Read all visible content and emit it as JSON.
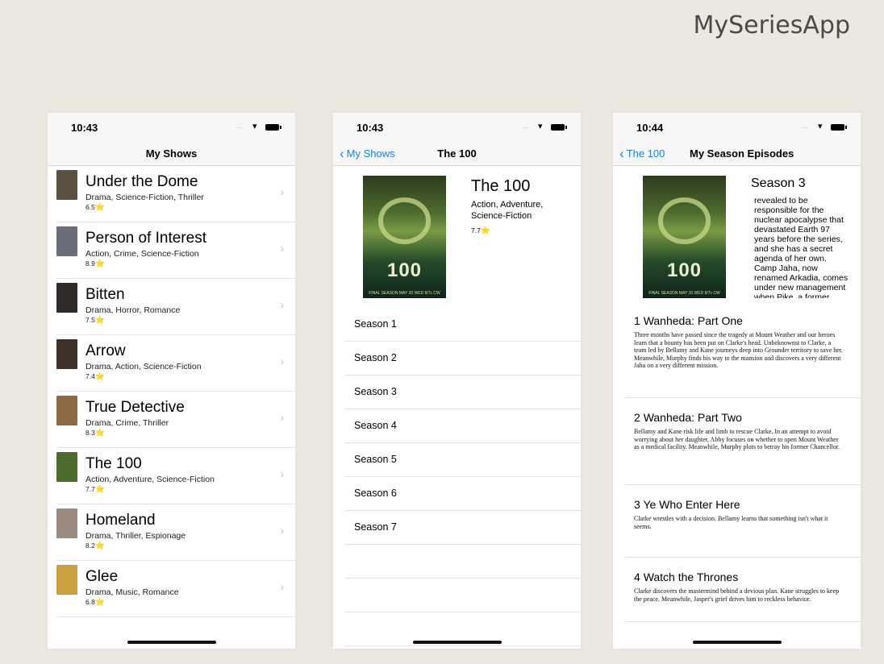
{
  "app_title": "MySeriesApp",
  "colors": {
    "accent": "#1a7ef0",
    "background": "#ebe8e1",
    "star": "#f4c430"
  },
  "screen1": {
    "time": "10:43",
    "nav_title": "My Shows",
    "shows": [
      {
        "name": "Under the Dome",
        "genres": "Drama, Science-Fiction, Thriller",
        "rating": "6.5",
        "thumb_color": "#5a5040"
      },
      {
        "name": "Person of Interest",
        "genres": "Action, Crime, Science-Fiction",
        "rating": "8.9",
        "thumb_color": "#6b6e78"
      },
      {
        "name": "Bitten",
        "genres": "Drama, Horror, Romance",
        "rating": "7.5",
        "thumb_color": "#2e2a2a"
      },
      {
        "name": "Arrow",
        "genres": "Drama, Action, Science-Fiction",
        "rating": "7.4",
        "thumb_color": "#3a3228"
      },
      {
        "name": "True Detective",
        "genres": "Drama, Crime, Thriller",
        "rating": "8.3",
        "thumb_color": "#8b6a45"
      },
      {
        "name": "The 100",
        "genres": "Action, Adventure, Science-Fiction",
        "rating": "7.7",
        "thumb_color": "#4d6b2e"
      },
      {
        "name": "Homeland",
        "genres": "Drama, Thriller, Espionage",
        "rating": "8.2",
        "thumb_color": "#9a8a80"
      },
      {
        "name": "Glee",
        "genres": "Drama, Music, Romance",
        "rating": "6.8",
        "thumb_color": "#c8a040"
      }
    ]
  },
  "screen2": {
    "time": "10:43",
    "back_label": "My Shows",
    "nav_title": "The 100",
    "show_title": "The 100",
    "genres": "Action, Adventure, Science-Fiction",
    "rating": "7.7",
    "poster_text": "100",
    "poster_footer": "FINAL SEASON MAY 20 WED 8/7c CW",
    "seasons": [
      "Season 1",
      "Season 2",
      "Season 3",
      "Season 4",
      "Season 5",
      "Season 6",
      "Season 7"
    ]
  },
  "screen3": {
    "time": "10:44",
    "back_label": "The 100",
    "nav_title": "My Season Episodes",
    "season_heading": "Season 3",
    "season_overview": "revealed to be responsible for the nuclear apocalypse that devastated Earth 97 years before the series, and she has a secret agenda of her own. Camp Jaha, now renamed Arkadia, comes under new management when Pike, a former",
    "poster_text": "100",
    "poster_footer": "FINAL SEASON MAY 20 WED 8/7c CW",
    "episodes": [
      {
        "number": "1",
        "title": "Wanheda: Part One",
        "overview": "Three months have passed since the tragedy at Mount Weather and our heroes learn that a bounty has been put on Clarke's head. Unbeknownst to Clarke, a team led by Bellamy and Kane journeys deep into Grounder territory to save her. Meanwhile, Murphy finds his way to the mansion and discovers a very different Jaha on a very different mission."
      },
      {
        "number": "2",
        "title": "Wanheda: Part Two",
        "overview": "Bellamy and Kane risk life and limb to rescue Clarke. In an attempt to avoid worrying about her daughter, Abby focuses on whether to open Mount Weather as a medical facility. Meanwhile, Murphy plots to betray his former Chancellor."
      },
      {
        "number": "3",
        "title": "Ye Who Enter Here",
        "overview": "Clarke wrestles with a decision. Bellamy learns that something isn't what it seems."
      },
      {
        "number": "4",
        "title": "Watch the Thrones",
        "overview": "Clarke discovers the mastermind behind a devious plan. Kane struggles to keep the peace. Meanwhile, Jasper's grief drives him to reckless behavior."
      }
    ]
  }
}
